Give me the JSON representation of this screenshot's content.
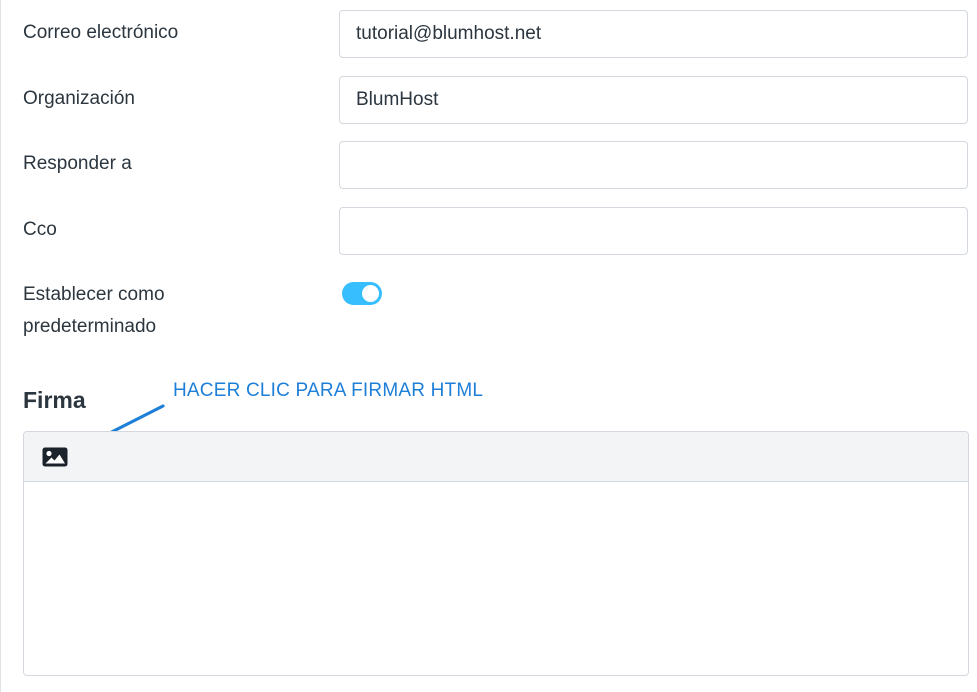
{
  "form": {
    "email": {
      "label": "Correo electrónico",
      "value": "tutorial@blumhost.net"
    },
    "organization": {
      "label": "Organización",
      "value": "BlumHost"
    },
    "reply_to": {
      "label": "Responder a",
      "value": ""
    },
    "bcc": {
      "label": "Cco",
      "value": ""
    },
    "default": {
      "label_line1": "Establecer como",
      "label_line2": "predeterminado",
      "enabled": true
    }
  },
  "signature": {
    "title": "Firma",
    "toolbar": {
      "image_icon": "image-icon"
    },
    "content": ""
  },
  "annotation": {
    "text": "HACER CLIC PARA FIRMAR HTML",
    "color": "#1e7fd8"
  },
  "colors": {
    "toggle_on": "#37beff",
    "text": "#2c363f",
    "border": "#d3d8de"
  }
}
